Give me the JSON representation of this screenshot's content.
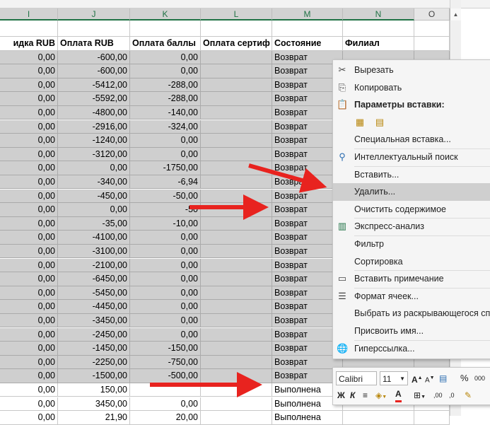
{
  "columns": [
    "I",
    "J",
    "K",
    "L",
    "M",
    "N",
    "O"
  ],
  "header": {
    "discount": "идка RUB",
    "payment_rub": "Оплата RUB",
    "payment_points": "Оплата баллы",
    "payment_cert": "Оплата сертиф",
    "status": "Состояние",
    "branch": "Филиал"
  },
  "rows": [
    {
      "i": "0,00",
      "j": "-600,00",
      "k": "0,00",
      "m": "Возврат",
      "sel": true
    },
    {
      "i": "0,00",
      "j": "-600,00",
      "k": "0,00",
      "m": "Возврат",
      "sel": true
    },
    {
      "i": "0,00",
      "j": "-5412,00",
      "k": "-288,00",
      "m": "Возврат",
      "sel": true
    },
    {
      "i": "0,00",
      "j": "-5592,00",
      "k": "-288,00",
      "m": "Возврат",
      "sel": true
    },
    {
      "i": "0,00",
      "j": "-4800,00",
      "k": "-140,00",
      "m": "Возврат",
      "sel": true
    },
    {
      "i": "0,00",
      "j": "-2916,00",
      "k": "-324,00",
      "m": "Возврат",
      "sel": true
    },
    {
      "i": "0,00",
      "j": "-1240,00",
      "k": "0,00",
      "m": "Возврат",
      "sel": true
    },
    {
      "i": "0,00",
      "j": "-3120,00",
      "k": "0,00",
      "m": "Возврат",
      "sel": true
    },
    {
      "i": "0,00",
      "j": "0,00",
      "k": "-1750,00",
      "m": "Возврат",
      "sel": true
    },
    {
      "i": "0,00",
      "j": "-340,00",
      "k": "-6,94",
      "m": "Возврат",
      "sel": true
    },
    {
      "i": "0,00",
      "j": "-450,00",
      "k": "-50,00",
      "m": "Возврат",
      "sel": true
    },
    {
      "i": "0,00",
      "j": "0,00",
      "k": "-50",
      "m": "Возврат",
      "sel": true
    },
    {
      "i": "0,00",
      "j": "-35,00",
      "k": "-10,00",
      "m": "Возврат",
      "sel": true
    },
    {
      "i": "0,00",
      "j": "-4100,00",
      "k": "0,00",
      "m": "Возврат",
      "sel": true
    },
    {
      "i": "0,00",
      "j": "-3100,00",
      "k": "0,00",
      "m": "Возврат",
      "sel": true
    },
    {
      "i": "0,00",
      "j": "-2100,00",
      "k": "0,00",
      "m": "Возврат",
      "sel": true
    },
    {
      "i": "0,00",
      "j": "-6450,00",
      "k": "0,00",
      "m": "Возврат",
      "sel": true
    },
    {
      "i": "0,00",
      "j": "-5450,00",
      "k": "0,00",
      "m": "Возврат",
      "sel": true
    },
    {
      "i": "0,00",
      "j": "-4450,00",
      "k": "0,00",
      "m": "Возврат",
      "sel": true
    },
    {
      "i": "0,00",
      "j": "-3450,00",
      "k": "0,00",
      "m": "Возврат",
      "sel": true
    },
    {
      "i": "0,00",
      "j": "-2450,00",
      "k": "0,00",
      "m": "Возврат",
      "sel": true
    },
    {
      "i": "0,00",
      "j": "-1450,00",
      "k": "-150,00",
      "m": "Возврат",
      "sel": true
    },
    {
      "i": "0,00",
      "j": "-2250,00",
      "k": "-750,00",
      "m": "Возврат",
      "sel": true
    },
    {
      "i": "0,00",
      "j": "-1500,00",
      "k": "-500,00",
      "m": "Возврат",
      "sel": true
    },
    {
      "i": "0,00",
      "j": "150,00",
      "k": "",
      "m": "Выполнена",
      "sel": false
    },
    {
      "i": "0,00",
      "j": "3450,00",
      "k": "0,00",
      "m": "Выполнена",
      "sel": false
    },
    {
      "i": "0,00",
      "j": "21,90",
      "k": "20,00",
      "m": "Выполнена",
      "sel": false
    }
  ],
  "context_menu": {
    "cut": "Вырезать",
    "copy": "Копировать",
    "paste_options": "Параметры вставки:",
    "paste_special": "Специальная вставка...",
    "smart_lookup": "Интеллектуальный поиск",
    "insert": "Вставить...",
    "delete": "Удалить...",
    "clear_contents": "Очистить содержимое",
    "quick_analysis": "Экспресс-анализ",
    "filter": "Фильтр",
    "sort": "Сортировка",
    "insert_comment": "Вставить примечание",
    "format_cells": "Формат ячеек...",
    "pick_from_list": "Выбрать из раскрывающегося спи",
    "define_name": "Присвоить имя...",
    "hyperlink": "Гиперссылка..."
  },
  "mini_toolbar": {
    "font": "Calibri",
    "size": "11",
    "percent": "%",
    "thousands": "000",
    "bold": "Ж",
    "italic": "К"
  },
  "colors": {
    "arrow": "#e8231f",
    "selection": "#cfcfcf",
    "accent": "#217346"
  }
}
